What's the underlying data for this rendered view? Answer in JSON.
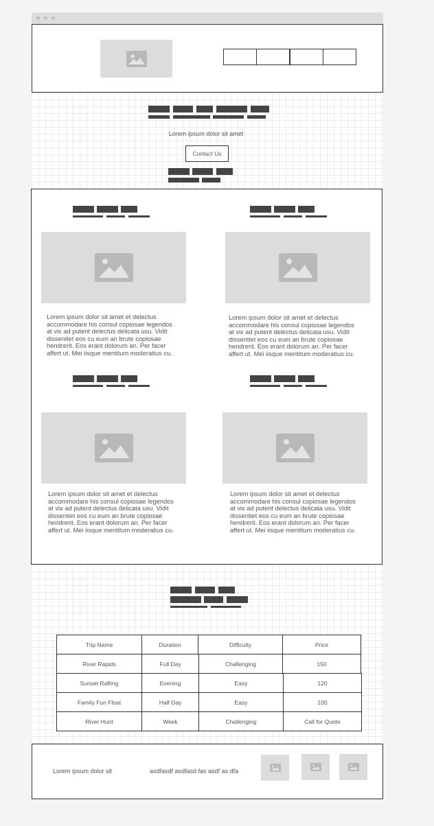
{
  "hero": {
    "tagline": "Lorem ipsum dolor sit amet",
    "contact_label": "Contact Us"
  },
  "cards": [
    {
      "body": "Lorem ipsum dolor sit amet et delectus accommodare his consul copiosae legendos at vix ad putent delectus delicata usu. Vidit dissentiet eos cu eum an brute copiosae hendrerit. Eos erant dolorum an. Per facer affert ut. Mei iisque mentitum moderatius cu."
    },
    {
      "body": "Lorem ipsum dolor sit amet et delectus accommodare his consul copiosae legendos at vix ad putent delectus delicata usu. Vidit dissentiet eos cu eum an brute copiosae hendrerit. Eos erant dolorum an. Per facer affert ut. Mei iisque mentitum moderatius cu."
    },
    {
      "body": "Lorem ipsum dolor sit amet et delectus accommodare his consul copiosae legendos at vix ad putent delectus delicata usu. Vidit dissentiet eos cu eum an brute copiosae hendrerit. Eos erant dolorum an. Per facer affert ut. Mei iisque mentitum moderatius cu."
    },
    {
      "body": "Lorem ipsum dolor sit amet et delectus accommodare his consul copiosae legendos at vix ad putent delectus delicata usu. Vidit dissentiet eos cu eum an brute copiosae hendrerit. Eos erant dolorum an. Per facer affert ut. Mei iisque mentitum moderatius cu."
    }
  ],
  "table": {
    "headers": [
      "Trip Name",
      "Duration",
      "Difficulty",
      "Price"
    ],
    "rows": [
      [
        "River Rapids",
        "Full Day",
        "Challenging",
        "150"
      ],
      [
        "Sunset Rafting",
        "Evening",
        "Easy",
        "120"
      ],
      [
        "Family Fun Float",
        "Half Day",
        "Easy",
        "100"
      ],
      [
        "River Hunt",
        "Week",
        "Challenging",
        "Call for Quote"
      ]
    ]
  },
  "footer": {
    "text_left": "Lorem ipsum dolor sit",
    "text_mid": "asdfasdf asdfasd fas asdf as dfa"
  },
  "icons": {
    "image_placeholder": "image-icon"
  }
}
